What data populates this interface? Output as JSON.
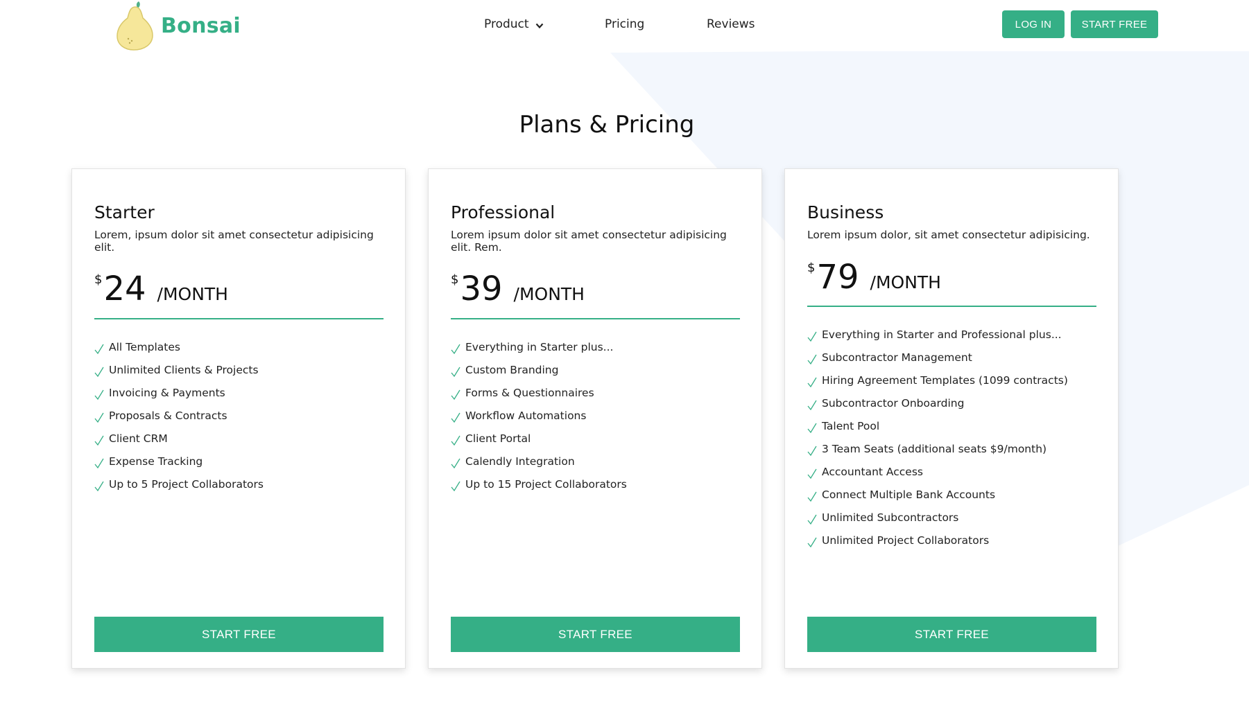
{
  "brand": {
    "name": "Bonsai",
    "accent_color": "#35af86",
    "logo_icon": "pear-icon"
  },
  "nav": {
    "items": [
      {
        "label": "Product",
        "icon": "chevron-down-icon"
      },
      {
        "label": "Pricing"
      },
      {
        "label": "Reviews"
      }
    ]
  },
  "header_buttons": {
    "login": "LOG IN",
    "start": "START FREE"
  },
  "page_title": "Plans & Pricing",
  "plans": [
    {
      "name": "Starter",
      "description": "Lorem, ipsum dolor sit amet consectetur adipisicing elit.",
      "currency": "$",
      "price": "24",
      "period": "/MONTH",
      "features": [
        "All Templates",
        "Unlimited Clients & Projects",
        "Invoicing & Payments",
        "Proposals & Contracts",
        "Client CRM",
        "Expense Tracking",
        "Up to 5 Project Collaborators"
      ],
      "cta": "START FREE"
    },
    {
      "name": "Professional",
      "description": "Lorem ipsum dolor sit amet consectetur adipisicing elit. Rem.",
      "currency": "$",
      "price": "39",
      "period": "/MONTH",
      "features": [
        "Everything in Starter plus...",
        "Custom Branding",
        "Forms & Questionnaires",
        "Workflow Automations",
        "Client Portal",
        "Calendly Integration",
        "Up to 15 Project Collaborators"
      ],
      "cta": "START FREE"
    },
    {
      "name": "Business",
      "description": "Lorem ipsum dolor, sit amet consectetur adipisicing.",
      "currency": "$",
      "price": "79",
      "period": "/MONTH",
      "features": [
        "Everything in Starter and Professional plus...",
        "Subcontractor Management",
        "Hiring Agreement Templates (1099 contracts)",
        "Subcontractor Onboarding",
        "Talent Pool",
        "3 Team Seats (additional seats $9/month)",
        "Accountant Access",
        "Connect Multiple Bank Accounts",
        "Unlimited Subcontractors",
        "Unlimited Project Collaborators"
      ],
      "cta": "START FREE"
    }
  ],
  "check_icon": "check-icon"
}
